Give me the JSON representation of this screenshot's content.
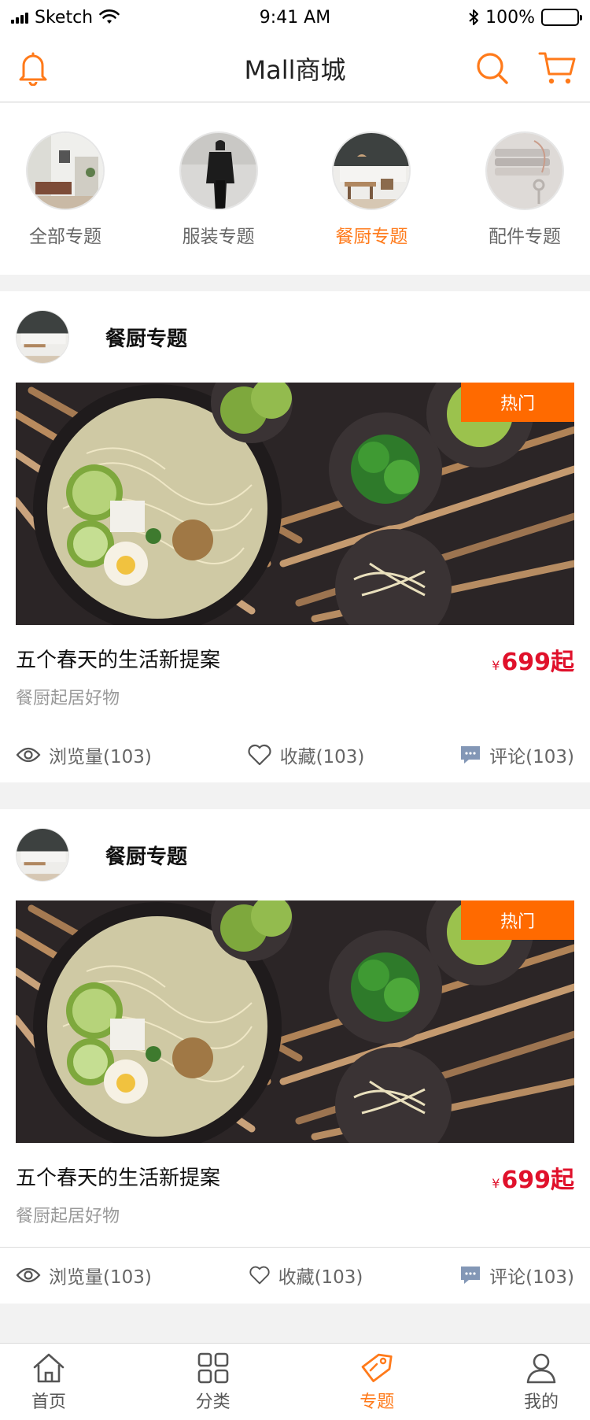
{
  "status_bar": {
    "carrier": "Sketch",
    "time": "9:41 AM",
    "battery": "100%"
  },
  "header": {
    "title": "Mall商城",
    "icons": [
      "bell-icon",
      "search-icon",
      "cart-icon"
    ]
  },
  "topics": [
    {
      "label": "全部专题",
      "active": false
    },
    {
      "label": "服装专题",
      "active": false
    },
    {
      "label": "餐厨专题",
      "active": true
    },
    {
      "label": "配件专题",
      "active": false
    }
  ],
  "cards": [
    {
      "head_title": "餐厨专题",
      "badge": "热门",
      "title": "五个春天的生活新提案",
      "subtitle": "餐厨起居好物",
      "price_symbol": "¥",
      "price": "699起",
      "views": "浏览量(103)",
      "favorites": "收藏(103)",
      "comments": "评论(103)"
    },
    {
      "head_title": "餐厨专题",
      "badge": "热门",
      "title": "五个春天的生活新提案",
      "subtitle": "餐厨起居好物",
      "price_symbol": "¥",
      "price": "699起",
      "views": "浏览量(103)",
      "favorites": "收藏(103)",
      "comments": "评论(103)"
    }
  ],
  "tab_bar": {
    "tabs": [
      {
        "label": "首页",
        "icon": "home-icon",
        "active": false
      },
      {
        "label": "分类",
        "icon": "grid-icon",
        "active": false
      },
      {
        "label": "专题",
        "icon": "tag-icon",
        "active": true
      },
      {
        "label": "我的",
        "icon": "user-icon",
        "active": false
      }
    ]
  },
  "colors": {
    "accent": "#ff7a1a",
    "price": "#e0112b",
    "badge": "#ff6a00"
  }
}
